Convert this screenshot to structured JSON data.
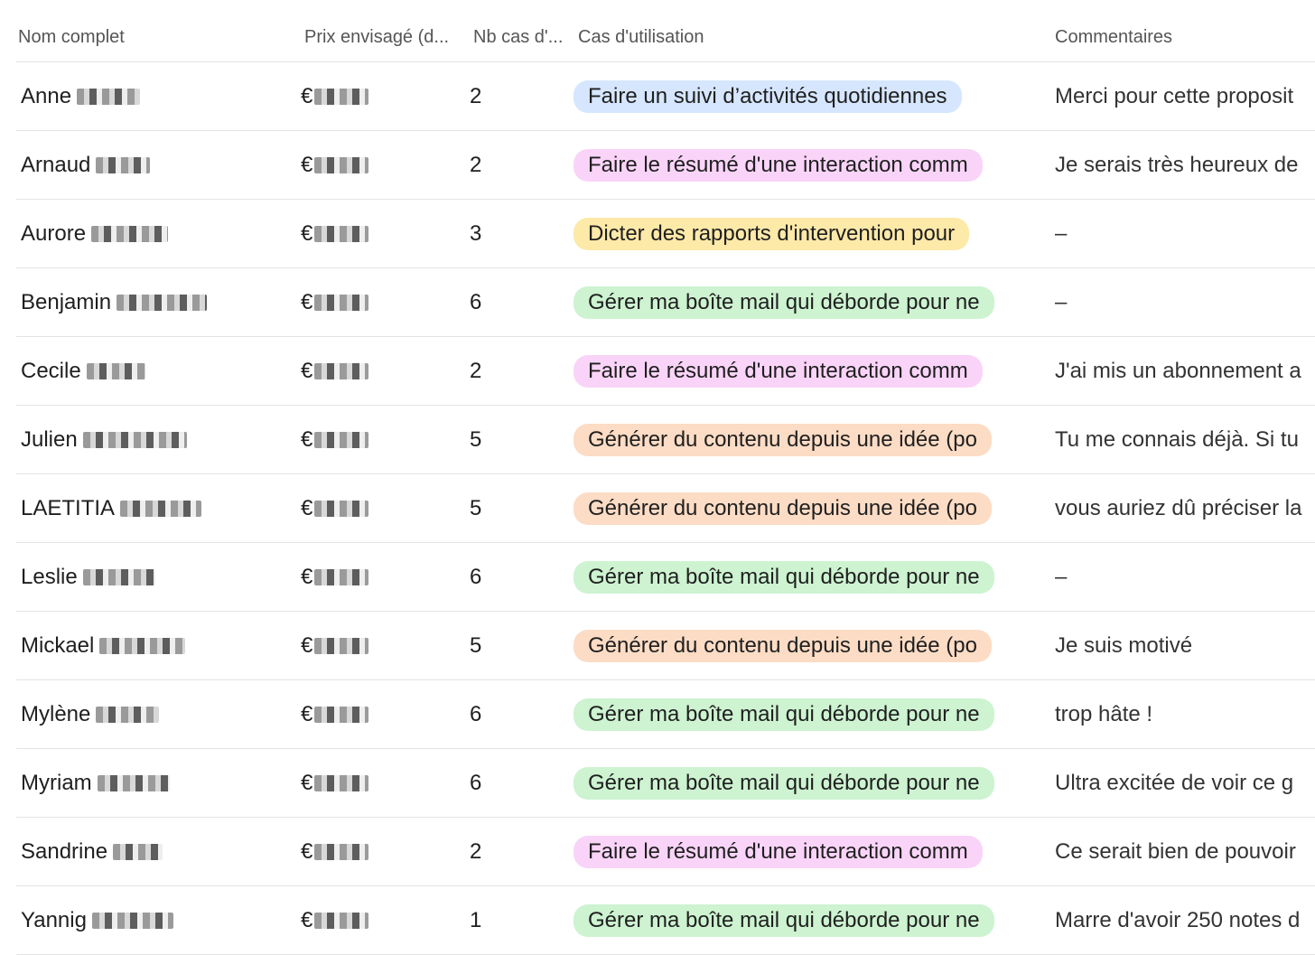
{
  "headers": {
    "name": "Nom complet",
    "price": "Prix envisagé (d...",
    "nb": "Nb cas d'...",
    "use": "Cas d'utilisation",
    "comments": "Commentaires"
  },
  "colors": {
    "blue_pill": "#d6e6ff",
    "pink_pill": "#f9d4f8",
    "yellow_pill": "#fde9a8",
    "green_pill": "#cdf3d1",
    "orange_pill": "#fcdcc5"
  },
  "rows": [
    {
      "name": "Anne",
      "price": "€",
      "nb": "2",
      "use": "Faire un suivi d’activités quotidiennes",
      "color": "#d6e6ff",
      "comment": "Merci pour cette proposit"
    },
    {
      "name": "Arnaud",
      "price": "€",
      "nb": "2",
      "use": "Faire le résumé d'une interaction comm",
      "color": "#f9d4f8",
      "comment": "Je serais très heureux de"
    },
    {
      "name": "Aurore",
      "price": "€",
      "nb": "3",
      "use": "Dicter des rapports d'intervention pour",
      "color": "#fde9a8",
      "comment": "–"
    },
    {
      "name": "Benjamin",
      "price": "€",
      "nb": "6",
      "use": "Gérer ma boîte mail qui déborde pour ne",
      "color": "#cdf3d1",
      "comment": "–"
    },
    {
      "name": "Cecile",
      "price": "€",
      "nb": "2",
      "use": "Faire le résumé d'une interaction comm",
      "color": "#f9d4f8",
      "comment": "J'ai mis un abonnement a"
    },
    {
      "name": "Julien",
      "price": "€",
      "nb": "5",
      "use": "Générer du contenu depuis une idée (po",
      "color": "#fcdcc5",
      "comment": "Tu me connais déjà. Si tu"
    },
    {
      "name": "LAETITIA",
      "price": "€",
      "nb": "5",
      "use": "Générer du contenu depuis une idée (po",
      "color": "#fcdcc5",
      "comment": "vous auriez dû préciser la"
    },
    {
      "name": "Leslie",
      "price": "€",
      "nb": "6",
      "use": "Gérer ma boîte mail qui déborde pour ne",
      "color": "#cdf3d1",
      "comment": "–"
    },
    {
      "name": "Mickael",
      "price": "€",
      "nb": "5",
      "use": "Générer du contenu depuis une idée (po",
      "color": "#fcdcc5",
      "comment": "Je suis motivé"
    },
    {
      "name": "Mylène",
      "price": "€",
      "nb": "6",
      "use": "Gérer ma boîte mail qui déborde pour ne",
      "color": "#cdf3d1",
      "comment": "trop hâte !"
    },
    {
      "name": "Myriam",
      "price": "€",
      "nb": "6",
      "use": "Gérer ma boîte mail qui déborde pour ne",
      "color": "#cdf3d1",
      "comment": "Ultra excitée de voir ce g"
    },
    {
      "name": "Sandrine",
      "price": "€",
      "nb": "2",
      "use": "Faire le résumé d'une interaction comm",
      "color": "#f9d4f8",
      "comment": "Ce serait bien de pouvoir"
    },
    {
      "name": "Yannig",
      "price": "€",
      "nb": "1",
      "use": "Gérer ma boîte mail qui déborde pour ne",
      "color": "#cdf3d1",
      "comment": "Marre d'avoir 250 notes d"
    }
  ]
}
